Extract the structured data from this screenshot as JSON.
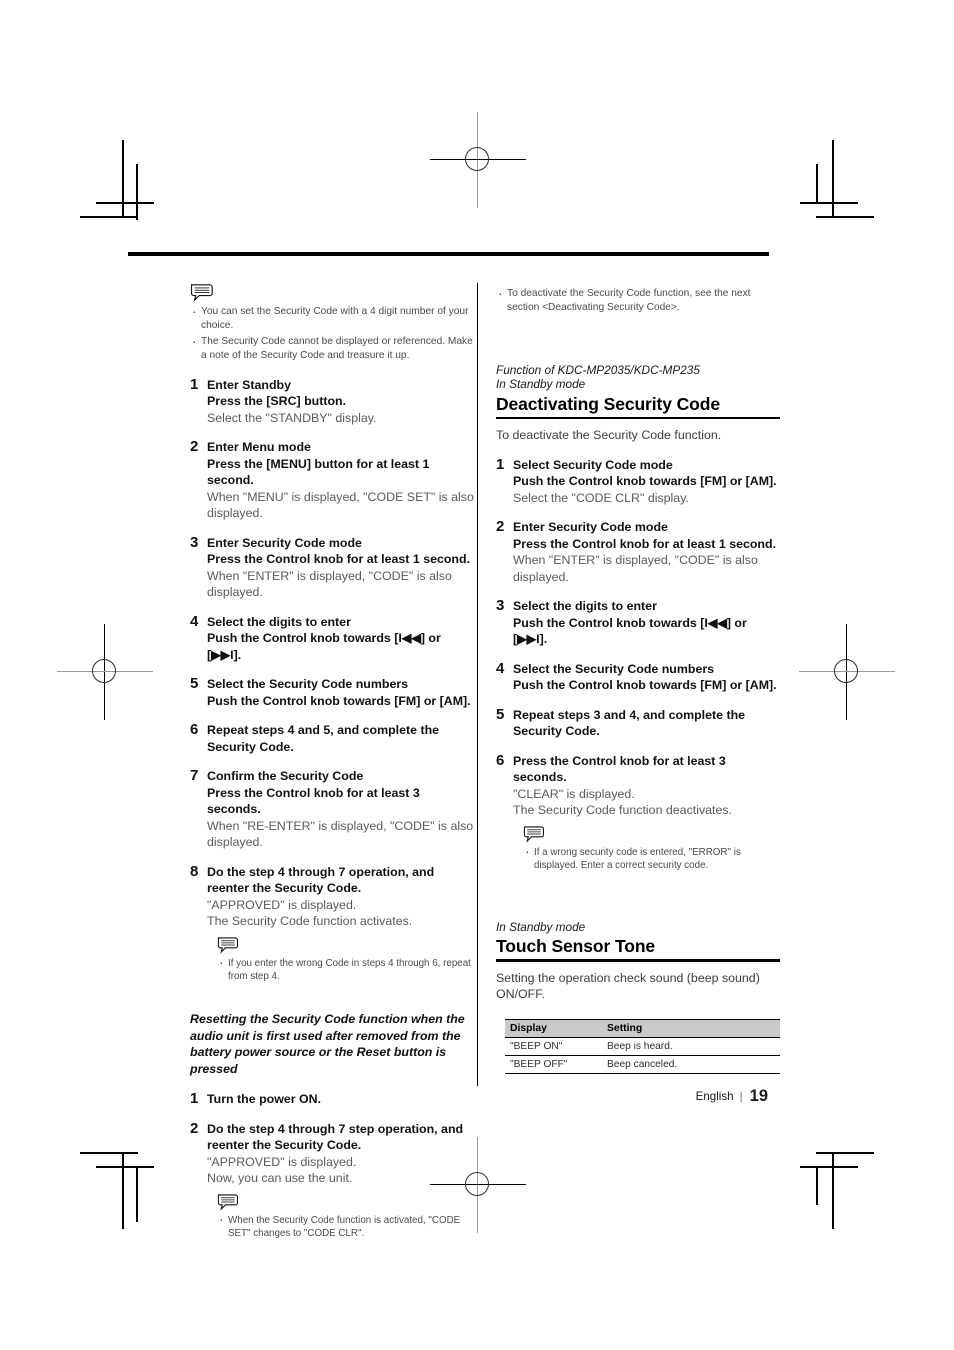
{
  "page": {
    "footer_language": "English",
    "footer_separator": "|",
    "footer_page_number": "19"
  },
  "left_column": {
    "note_top": {
      "icon": "note-bubble-icon",
      "bullets": [
        "You can set the Security Code with a 4 digit number of your choice.",
        "The Security Code cannot be displayed or referenced. Make a note of the Security Code and treasure it up."
      ]
    },
    "steps": [
      {
        "num": "1",
        "title": "Enter Standby",
        "action": "Press the [SRC] button.",
        "result": "Select the \"STANDBY\" display."
      },
      {
        "num": "2",
        "title": "Enter Menu mode",
        "action": "Press the [MENU] button for at least 1 second.",
        "result": "When \"MENU\" is displayed, \"CODE SET\" is also displayed."
      },
      {
        "num": "3",
        "title": "Enter Security Code mode",
        "action": "Press the Control knob for at least 1 second.",
        "result": "When \"ENTER\" is displayed, \"CODE\" is also displayed."
      },
      {
        "num": "4",
        "title": "Select the digits to enter",
        "action": "Push the Control knob towards [I◀◀] or [▶▶I].",
        "result": ""
      },
      {
        "num": "5",
        "title": "Select the Security Code numbers",
        "action": "Push the Control knob towards [FM] or [AM].",
        "result": ""
      },
      {
        "num": "6",
        "title": "Repeat steps 4 and 5, and complete the Security Code.",
        "action": "",
        "result": ""
      },
      {
        "num": "7",
        "title": "Confirm the Security Code",
        "action": "Press the Control knob for at least 3 seconds.",
        "result": "When \"RE-ENTER\" is displayed, \"CODE\" is also displayed."
      },
      {
        "num": "8",
        "title": "Do the step 4 through 7 operation, and reenter the Security Code.",
        "action": "",
        "result": "\"APPROVED\" is displayed.\nThe Security Code function activates."
      }
    ],
    "note_after_step8": {
      "icon": "note-bubble-icon",
      "bullets": [
        "If you enter the wrong Code in steps 4 through 6, repeat from step 4."
      ]
    },
    "resetting_heading": "Resetting the Security Code function when the audio unit is first used after removed from the battery power source or the Reset button is pressed",
    "reset_steps": [
      {
        "num": "1",
        "title": "Turn the power ON.",
        "action": "",
        "result": ""
      },
      {
        "num": "2",
        "title": "Do the step 4 through 7 step operation, and reenter the Security Code.",
        "action": "",
        "result": "\"APPROVED\" is displayed.\nNow, you can use the unit."
      }
    ],
    "note_after_reset": {
      "icon": "note-bubble-icon",
      "bullets": [
        "When the Security Code function is activated, \"CODE SET\" changes to \"CODE CLR\"."
      ]
    }
  },
  "right_column": {
    "top_bullets": [
      "To deactivate the Security Code function, see the next section <Deactivating Security Code>."
    ],
    "deactivating_section": {
      "function_line": "Function of KDC-MP2035/KDC-MP235",
      "mode_line": "In Standby mode",
      "heading": "Deactivating Security Code",
      "intro": "To deactivate the Security Code function.",
      "steps": [
        {
          "num": "1",
          "title": "Select Security Code mode",
          "action": "Push the Control knob towards [FM] or [AM].",
          "result": "Select the \"CODE CLR\" display."
        },
        {
          "num": "2",
          "title": "Enter Security Code mode",
          "action": "Press the Control knob for at least 1 second.",
          "result": "When \"ENTER\" is displayed, \"CODE\" is also displayed."
        },
        {
          "num": "3",
          "title": "Select the digits to enter",
          "action": "Push the Control knob towards [I◀◀] or [▶▶I].",
          "result": ""
        },
        {
          "num": "4",
          "title": "Select the Security Code numbers",
          "action": "Push the Control knob towards [FM] or [AM].",
          "result": ""
        },
        {
          "num": "5",
          "title": "Repeat steps 3 and 4, and complete the Security Code.",
          "action": "",
          "result": ""
        },
        {
          "num": "6",
          "title": "Press the Control knob for at least 3 seconds.",
          "action": "",
          "result": "\"CLEAR\" is displayed.\nThe Security Code function deactivates."
        }
      ],
      "note": {
        "icon": "note-bubble-icon",
        "bullets": [
          "If a wrong security code is entered, \"ERROR\" is displayed. Enter a correct security code."
        ]
      }
    },
    "touch_sensor_section": {
      "mode_line": "In Standby mode",
      "heading": "Touch Sensor Tone",
      "intro": "Setting the operation check sound (beep sound) ON/OFF.",
      "table": {
        "headers": [
          "Display",
          "Setting"
        ],
        "rows": [
          [
            "\"BEEP ON\"",
            "Beep is heard."
          ],
          [
            "\"BEEP OFF\"",
            "Beep canceled."
          ]
        ]
      }
    }
  }
}
